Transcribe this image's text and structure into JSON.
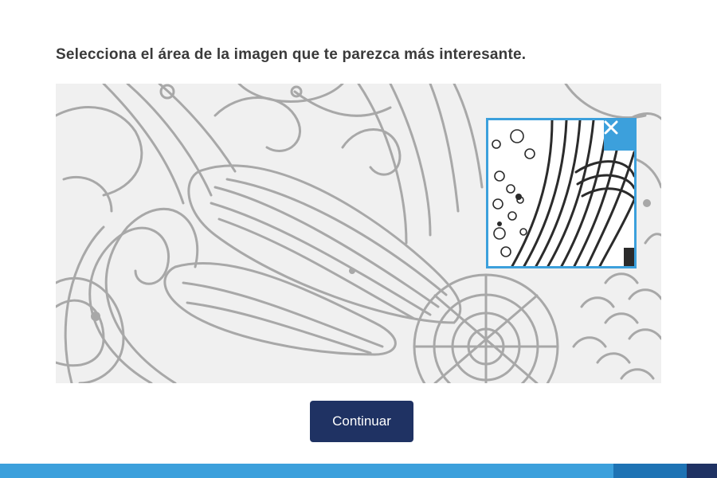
{
  "instruction": "Selecciona el área de la imagen que te parezca más interesante.",
  "image": {
    "icon": "doodle-artwork"
  },
  "selection": {
    "close_icon": "close-icon"
  },
  "continue_button": {
    "label": "Continuar"
  },
  "colors": {
    "accent": "#3ca0dc",
    "button": "#1f3263",
    "footer_light": "#3ca0dc",
    "footer_mid": "#1e73b4",
    "footer_dark": "#1f3263",
    "line_art": "#a8a8a8",
    "image_bg": "#f0f0f0"
  }
}
